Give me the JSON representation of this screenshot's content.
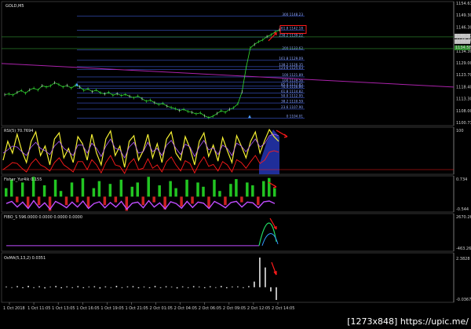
{
  "chart_data": [
    {
      "type": "line",
      "panel": "main",
      "title": "GOLD,M5",
      "ylim": [
        1100.73,
        1154.63
      ],
      "price_ticks": [
        "1154.63",
        "1149.30",
        "1146.30",
        "1139.30",
        "1134.30",
        "1129.00",
        "1123.70",
        "1118.40",
        "1113.30",
        "1108.00",
        "1100.73"
      ],
      "current_price_labels": [
        "1140.30",
        "1134.58",
        "1139.06"
      ],
      "fibonacci_levels": [
        {
          "label": "300 1148.23",
          "price": 1148.23
        },
        {
          "label": "261.8 1142.18",
          "price": 1142.18
        },
        {
          "label": "238.2 1139.22",
          "price": 1139.22
        },
        {
          "label": "200 1133.62",
          "price": 1133.62
        },
        {
          "label": "161.8 1129.09",
          "price": 1129.09
        },
        {
          "label": "138.2 1126.35",
          "price": 1126.35
        },
        {
          "label": "123.6 1125.03",
          "price": 1125.03
        },
        {
          "label": "100 1121.89",
          "price": 1121.89
        },
        {
          "label": "100 1119.56",
          "price": 1119.56
        },
        {
          "label": "85.4 1117.85",
          "price": 1117.85
        },
        {
          "label": "76.4 1116.86",
          "price": 1116.86
        },
        {
          "label": "61.8 1114.82",
          "price": 1114.82
        },
        {
          "label": "50.0 1112.95",
          "price": 1112.95
        },
        {
          "label": "38.2 1110.59",
          "price": 1110.59
        },
        {
          "label": "23.6 1107.90",
          "price": 1107.9
        },
        {
          "label": "0 1104.01",
          "price": 1104.01
        }
      ],
      "series": [
        {
          "values": [
            1114.2,
            1114.5,
            1114.0,
            1115.2,
            1116.0,
            1114.8,
            1116.3,
            1117.0,
            1116.2,
            1118.1,
            1117.5,
            1118.0,
            1119.4,
            1118.6,
            1117.5,
            1118.2,
            1117.0,
            1118.3,
            1117.6,
            1116.0,
            1116.7,
            1115.5,
            1116.2,
            1115.0,
            1114.5,
            1115.2,
            1113.9,
            1114.6,
            1113.8,
            1114.3,
            1113.5,
            1112.8,
            1113.6,
            1112.4,
            1111.3,
            1111.8,
            1110.7,
            1109.9,
            1110.4,
            1109.2,
            1108.6,
            1108.1,
            1107.3,
            1107.8,
            1106.9,
            1106.5,
            1105.8,
            1106.3,
            1105.0,
            1104.2,
            1104.8,
            1106.0,
            1107.2,
            1106.5,
            1107.8,
            1108.5,
            1110.2,
            1115.4,
            1126.0,
            1134.5,
            1136.0,
            1137.2,
            1138.0,
            1139.4,
            1140.2,
            1141.5,
            1142.3
          ]
        }
      ],
      "trend_line": {
        "from": 1125.0,
        "to": 1117.5
      },
      "horizontal_lines": [
        1139.3,
        1134.2
      ]
    },
    {
      "type": "line",
      "panel": "rsi",
      "title": "RSI(5) 70.7694",
      "ylim": [
        0,
        100
      ],
      "y_tick_top": "100",
      "series": [
        {
          "values": [
            30,
            70,
            45,
            85,
            50,
            25,
            70,
            90,
            40,
            60,
            20,
            75,
            88,
            35,
            55,
            25,
            80,
            65,
            30,
            85,
            45,
            20,
            75,
            92,
            40,
            60,
            15,
            70,
            82,
            30,
            50,
            85,
            35,
            65,
            25,
            75,
            90,
            45,
            30,
            80,
            55,
            20,
            70,
            88,
            38,
            62,
            28,
            78,
            50,
            25,
            82,
            60,
            35,
            70,
            90,
            45,
            72,
            95,
            80,
            70
          ]
        },
        {
          "values": [
            45,
            52,
            60,
            58,
            48,
            40,
            58,
            68,
            55,
            50,
            42,
            60,
            70,
            55,
            48,
            40,
            62,
            62,
            45,
            66,
            55,
            38,
            60,
            75,
            55,
            52,
            35,
            58,
            68,
            45,
            48,
            68,
            48,
            55,
            40,
            62,
            72,
            55,
            42,
            64,
            58,
            38,
            58,
            72,
            52,
            56,
            42,
            62,
            55,
            40,
            66,
            60,
            48,
            62,
            75,
            58,
            65,
            82,
            85,
            82
          ]
        }
      ]
    },
    {
      "type": "bar",
      "panel": "fisher",
      "title": "Fisher_Yur4ik 0.155",
      "ylim": [
        -0.544,
        0.734
      ],
      "y_ticks": [
        "0.734",
        "-0.544"
      ],
      "values": [
        0.3,
        0.6,
        -0.2,
        0.5,
        -0.4,
        0.7,
        -0.3,
        0.4,
        -0.5,
        0.6,
        0.2,
        -0.3,
        0.5,
        -0.2,
        0.65,
        -0.4,
        0.3,
        0.55,
        -0.3,
        0.45,
        -0.2,
        0.6,
        -0.5,
        0.35,
        0.5,
        -0.3,
        0.7,
        -0.2,
        0.4,
        -0.45,
        0.55,
        0.3,
        -0.35,
        0.6,
        -0.25,
        0.5,
        0.35,
        -0.4,
        0.6,
        0.2,
        -0.3,
        0.45,
        0.62,
        -0.2,
        0.5,
        0.4,
        -0.3,
        0.55,
        0.66,
        0.3
      ]
    },
    {
      "type": "line",
      "panel": "fibo_s",
      "title": "FIBO_S 596.0000 0.0000 0.0000 0.0000",
      "ylim": [
        -463.26,
        2670.26
      ],
      "y_ticks": [
        "2670.26",
        "-463.26"
      ]
    },
    {
      "type": "bar",
      "panel": "osma",
      "title": "OsMA(5,13,2) 0.0351",
      "ylim": [
        -0.0367,
        2.3828
      ],
      "y_ticks": [
        "2.3828",
        "-0.0367"
      ],
      "values": [
        0.05,
        -0.04,
        0.08,
        -0.06,
        0.1,
        -0.05,
        0.07,
        -0.08,
        0.04,
        0.09,
        -0.07,
        0.06,
        -0.05,
        0.08,
        -0.06,
        0.05,
        0.07,
        -0.09,
        0.06,
        -0.04,
        0.1,
        -0.05,
        0.06,
        0.08,
        -0.07,
        0.05,
        -0.06,
        0.09,
        -0.05,
        0.07,
        0.04,
        -0.08,
        0.06,
        -0.05,
        0.08,
        0.05,
        -0.06,
        0.07,
        -0.04,
        0.09,
        -0.07,
        0.05,
        0.06,
        -0.05,
        0.08,
        0.4,
        2.1,
        1.4,
        -0.3,
        -0.9
      ]
    }
  ],
  "time_axis": [
    "1 Oct 2018",
    "1 Oct 11:05",
    "1 Oct 13:05",
    "1 Oct 16:05",
    "1 Oct 19:05",
    "1 Oct 21:05",
    "2 Oct 01:05",
    "2 Oct 04:05",
    "2 Oct 06:05",
    "2 Oct 09:05",
    "2 Oct 12:05",
    "2 Oct 14:05"
  ],
  "watermark": "[1273x848] https://upic.me/",
  "colors": {
    "background": "#000000",
    "price_line": "#33dd33",
    "fib_lines": "#4a6cff",
    "trend_line": "#aa22aa",
    "rsi_fast": "#f5f032",
    "rsi_slow": "#b05cff",
    "rsi_signal": "#ff1a1a",
    "fisher_up": "#22c522",
    "fisher_down": "#cc2222",
    "highlight": "#ff1a1a",
    "osma": "#e6e6e6"
  }
}
